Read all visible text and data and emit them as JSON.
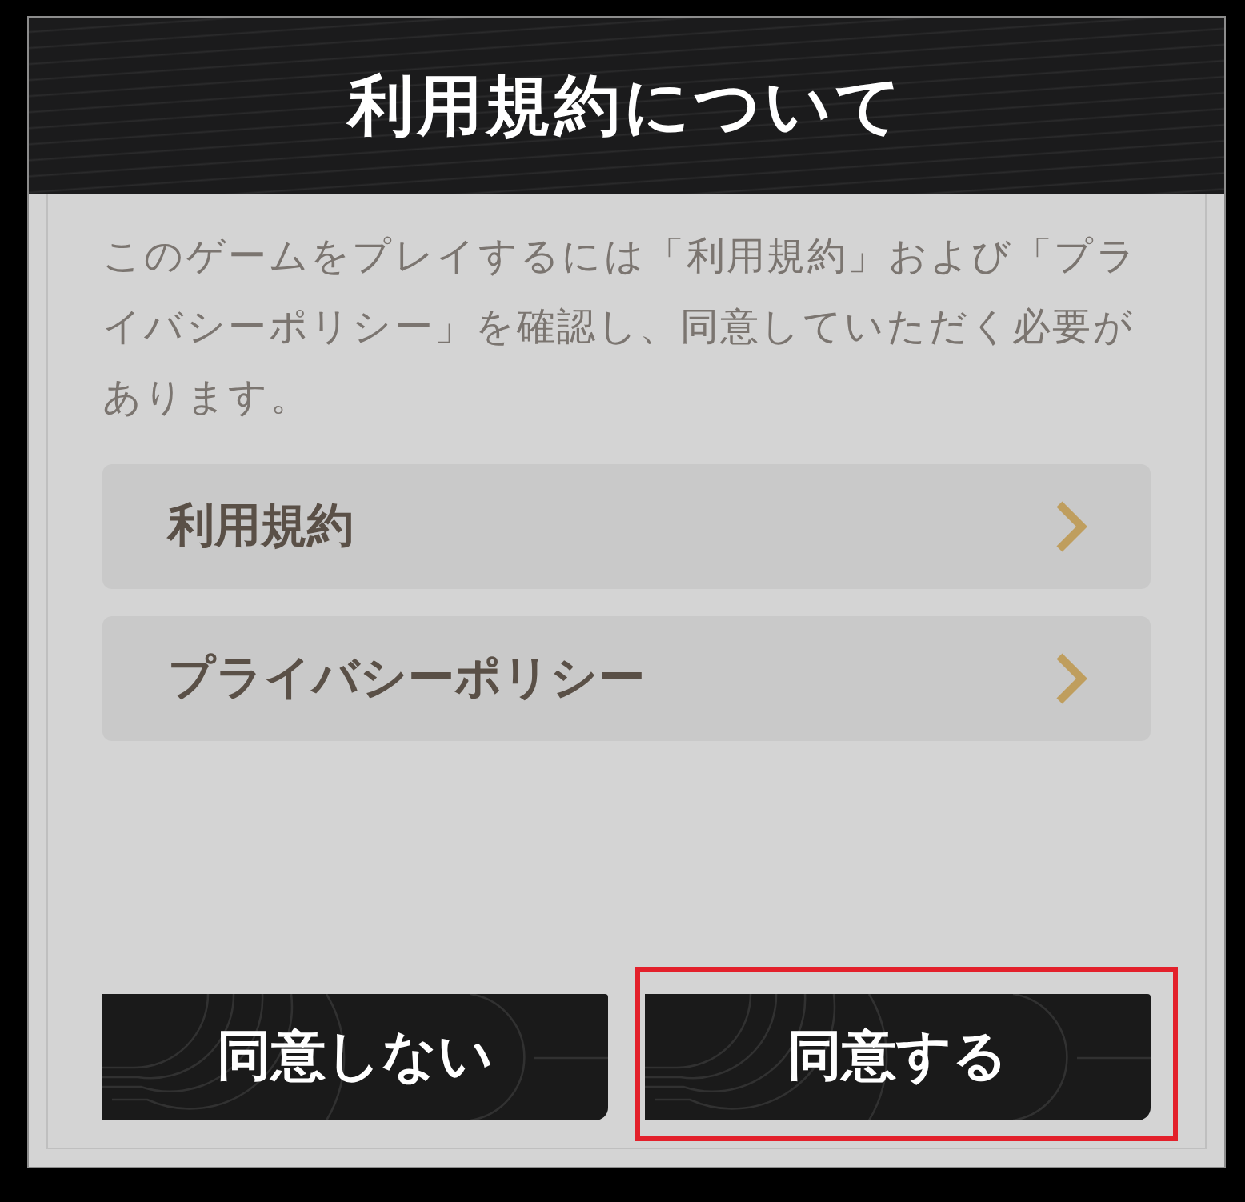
{
  "dialog": {
    "title": "利用規約について",
    "message": "このゲームをプレイするには「利用規約」および「プライバシーポリシー」を確認し、同意していただく必要があります。",
    "links": [
      {
        "label": "利用規約"
      },
      {
        "label": "プライバシーポリシー"
      }
    ],
    "buttons": [
      {
        "label": "同意しない",
        "highlighted": false
      },
      {
        "label": "同意する",
        "highlighted": true
      }
    ]
  }
}
